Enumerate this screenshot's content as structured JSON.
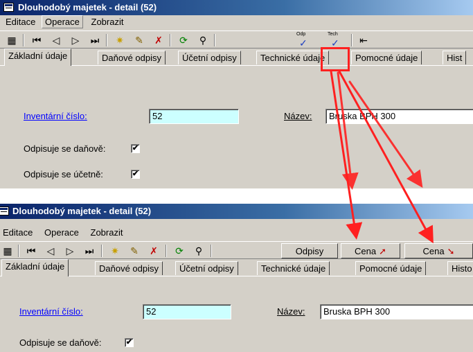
{
  "top": {
    "window_title": "Dlouhodobý majetek - detail (52)",
    "menu": [
      "Editace",
      "Operace",
      "Zobrazit"
    ],
    "tabs": [
      "Základní údaje",
      "Daňové odpisy",
      "Účetní odpisy",
      "Technické údaje",
      "Pomocné údaje",
      "Hist"
    ],
    "inventory_label": "Inventární číslo:",
    "inventory_value": "52",
    "name_label": "Název:",
    "name_value": "Bruska BPH 300",
    "tax_dep_label": "Odpisuje se daňově:",
    "acc_dep_label": "Odpisuje se účetně:",
    "odp_btn": "Odp",
    "tech_btn": "Tech"
  },
  "bottom": {
    "window_title": "Dlouhodobý majetek - detail (52)",
    "menu": [
      "Editace",
      "Operace",
      "Zobrazit"
    ],
    "toolbar_buttons": [
      "Odpisy",
      "Cena",
      "Cena"
    ],
    "tabs": [
      "Základní údaje",
      "Daňové odpisy",
      "Účetní odpisy",
      "Technické údaje",
      "Pomocné údaje",
      "Histo"
    ],
    "inventory_label": "Inventární číslo:",
    "inventory_value": "52",
    "name_label": "Název:",
    "name_value": "Bruska BPH 300",
    "tax_dep_label": "Odpisuje se daňově:"
  },
  "checked_mark": "✔",
  "colors": {
    "titlebar": "#0a246a",
    "field_cyan": "#ccffff",
    "annotation_red": "#ff2020",
    "link": "#0000ff"
  }
}
